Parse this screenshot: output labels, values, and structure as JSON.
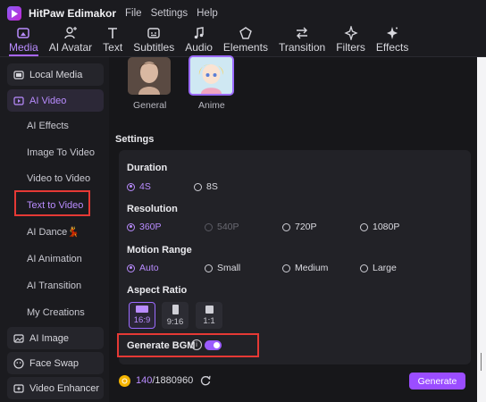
{
  "app": {
    "name": "HitPaw Edimakor",
    "menu": [
      "File",
      "Settings",
      "Help"
    ]
  },
  "toolbar": {
    "tabs": [
      {
        "label": "Media",
        "icon": "media-icon",
        "active": true
      },
      {
        "label": "AI Avatar",
        "icon": "avatar-icon"
      },
      {
        "label": "Text",
        "icon": "text-icon"
      },
      {
        "label": "Subtitles",
        "icon": "subtitles-icon"
      },
      {
        "label": "Audio",
        "icon": "audio-icon"
      },
      {
        "label": "Elements",
        "icon": "elements-icon"
      },
      {
        "label": "Transition",
        "icon": "transition-icon"
      },
      {
        "label": "Filters",
        "icon": "filters-icon"
      },
      {
        "label": "Effects",
        "icon": "effects-icon"
      }
    ]
  },
  "sidebar": {
    "local_media": "Local Media",
    "ai_video": "AI Video",
    "sub_items": [
      "AI Effects",
      "Image To Video",
      "Video to Video",
      "Text to Video",
      "AI Dance",
      "AI Animation",
      "AI Transition",
      "My Creations"
    ],
    "active_sub": "Text to Video",
    "ai_image": "AI Image",
    "face_swap": "Face Swap",
    "video_enhancer": "Video Enhancer"
  },
  "styles": [
    {
      "label": "General"
    },
    {
      "label": "Anime"
    }
  ],
  "settings": {
    "title": "Settings",
    "duration": {
      "label": "Duration",
      "options": [
        "4S",
        "8S"
      ],
      "selected": "4S"
    },
    "resolution": {
      "label": "Resolution",
      "options": [
        "360P",
        "540P",
        "720P",
        "1080P"
      ],
      "selected": "360P",
      "disabled": [
        "540P"
      ]
    },
    "motion_range": {
      "label": "Motion Range",
      "options": [
        "Auto",
        "Small",
        "Medium",
        "Large"
      ],
      "selected": "Auto"
    },
    "aspect_ratio": {
      "label": "Aspect Ratio",
      "options": [
        "16:9",
        "9:16",
        "1:1"
      ],
      "selected": "16:9"
    },
    "generate_bgm": {
      "label": "Generate BGM",
      "enabled": true
    }
  },
  "footer": {
    "credits_used": "140",
    "credits_total": "/1880960",
    "generate_label": "Generate"
  },
  "colors": {
    "accent": "#b98cff",
    "button": "#9b4dff",
    "highlight_box": "#e53935"
  }
}
